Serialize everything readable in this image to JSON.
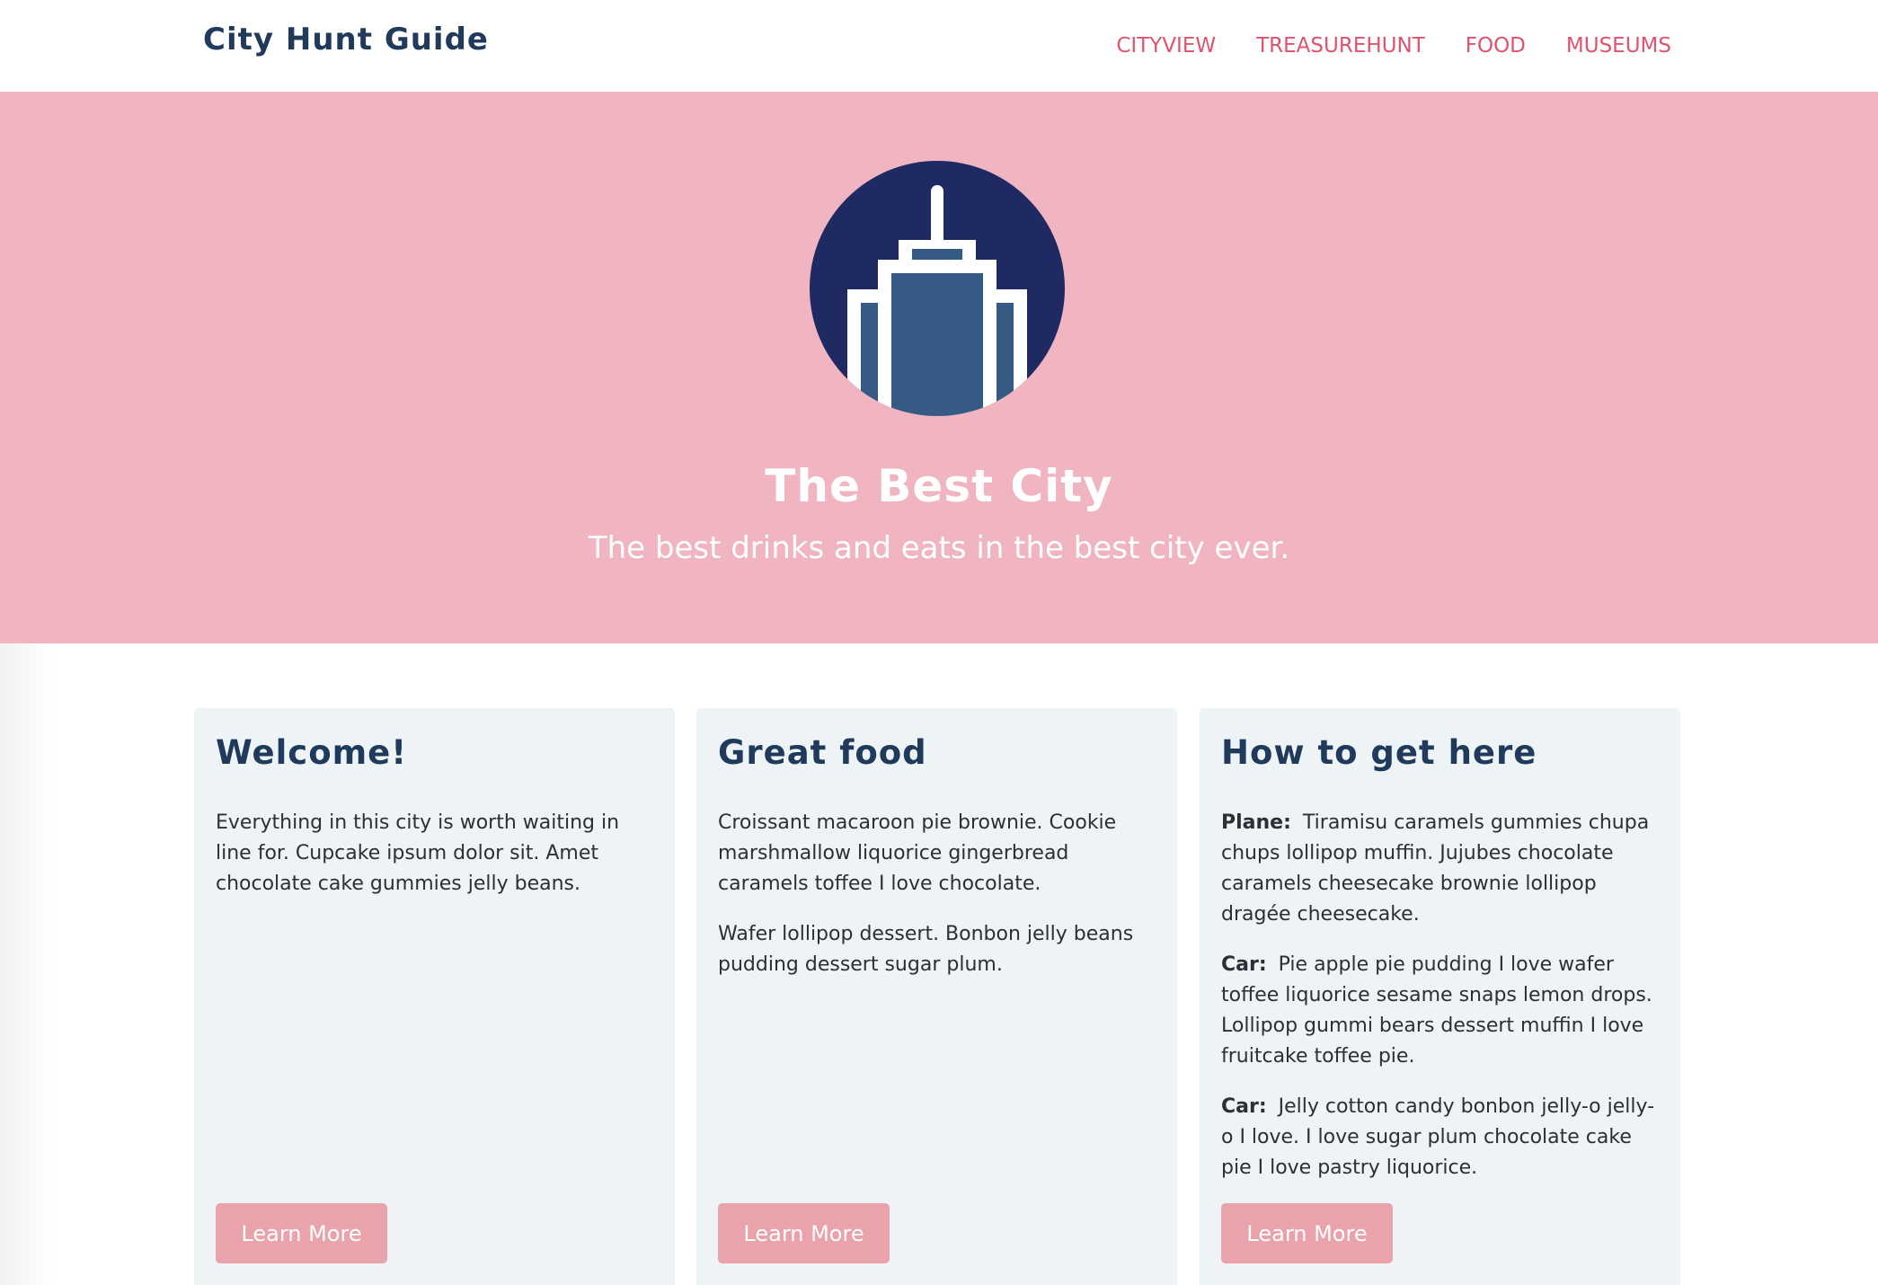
{
  "navbar": {
    "brand": "City Hunt Guide",
    "links": [
      "CITYVIEW",
      "TREASUREHUNT",
      "FOOD",
      "MUSEUMS"
    ]
  },
  "hero": {
    "icon": "skyscraper-icon",
    "title": "The Best City",
    "subtitle": "The best drinks and eats in the best city ever."
  },
  "cards": [
    {
      "title": "Welcome!",
      "paragraphs": [
        "Everything in this city is worth waiting in line for. Cupcake ipsum dolor sit. Amet chocolate cake gummies jelly beans."
      ],
      "button": "Learn More"
    },
    {
      "title": "Great food",
      "paragraphs": [
        "Croissant macaroon pie brownie. Cookie marshmallow liquorice gingerbread caramels toffee I love chocolate.",
        "Wafer lollipop dessert. Bonbon jelly beans pudding dessert sugar plum."
      ],
      "button": "Learn More"
    },
    {
      "title": "How to get here",
      "items": [
        {
          "label": "Plane:",
          "text": "Tiramisu caramels gummies chupa chups lollipop muffin. Jujubes chocolate caramels cheesecake brownie lollipop dragée cheesecake."
        },
        {
          "label": "Car:",
          "text": "Pie apple pie pudding I love wafer toffee liquorice sesame snaps lemon drops. Lollipop gummi bears dessert muffin I love fruitcake toffee pie."
        },
        {
          "label": "Car:",
          "text": "Jelly cotton candy bonbon jelly-o jelly-o I love. I love sugar plum chocolate cake pie I love pastry liquorice."
        }
      ],
      "button": "Learn More"
    }
  ],
  "colors": {
    "hero_bg": "#f0b5c0",
    "nav_link": "#e0536e",
    "brand": "#1f3a5a",
    "card_bg": "#eef3f6",
    "button_bg": "#eaa3aa",
    "logo_circle": "#1f2a63",
    "logo_building": "#355b84"
  }
}
